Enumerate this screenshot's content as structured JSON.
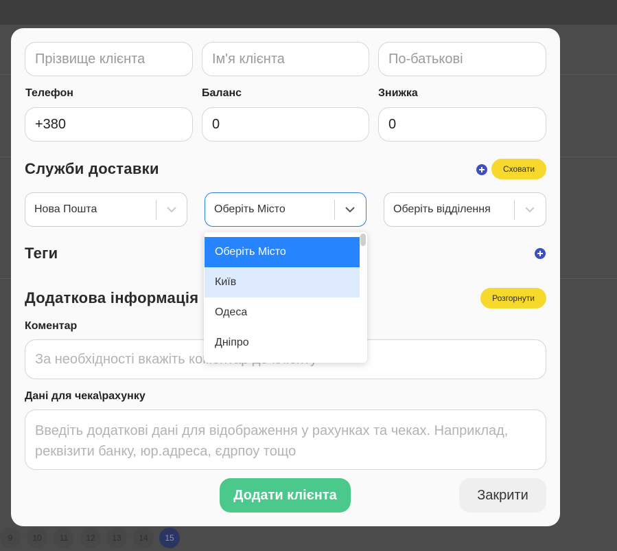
{
  "form": {
    "last_name_placeholder": "Прізвище клієнта",
    "first_name_placeholder": "Ім'я клієнта",
    "patronymic_placeholder": "По-батькові",
    "phone_label": "Телефон",
    "phone_value": "+380",
    "balance_label": "Баланс",
    "balance_value": "0",
    "discount_label": "Знижка",
    "discount_value": "0"
  },
  "delivery": {
    "title": "Служби доставки",
    "hide_label": "Сховати",
    "service_value": "Нова Пошта",
    "city_value": "Оберіть Місто",
    "branch_value": "Оберіть відділення",
    "city_options": [
      "Оберіть Місто",
      "Київ",
      "Одеса",
      "Дніпро"
    ],
    "city_selected_index": 0,
    "city_hover_index": 1
  },
  "tags": {
    "title": "Теги"
  },
  "extra": {
    "title": "Додаткова інформація",
    "expand_label": "Розгорнути",
    "comment_label": "Коментар",
    "comment_placeholder": "За необхідності вкажіть коментар до клієнту",
    "receipt_label": "Дані для чека\\рахунку",
    "receipt_placeholder": "Введіть додаткові дані для відображення у рахунках та чеках. Наприклад, реквізити банку, юр.адреса, єдрпоу тощо"
  },
  "actions": {
    "add_label": "Додати клієнта",
    "close_label": "Закрити"
  },
  "background": {
    "pages": [
      "9",
      "10",
      "11",
      "12",
      "13",
      "14",
      "15"
    ],
    "active_page": "15"
  },
  "colors": {
    "primary_green": "#4bc88c",
    "accent_yellow": "#f7d92e",
    "plus_blue": "#3e4fc4",
    "select_focus": "#2e7dd6",
    "option_selected": "#2684ff",
    "option_hover": "#deebff"
  }
}
